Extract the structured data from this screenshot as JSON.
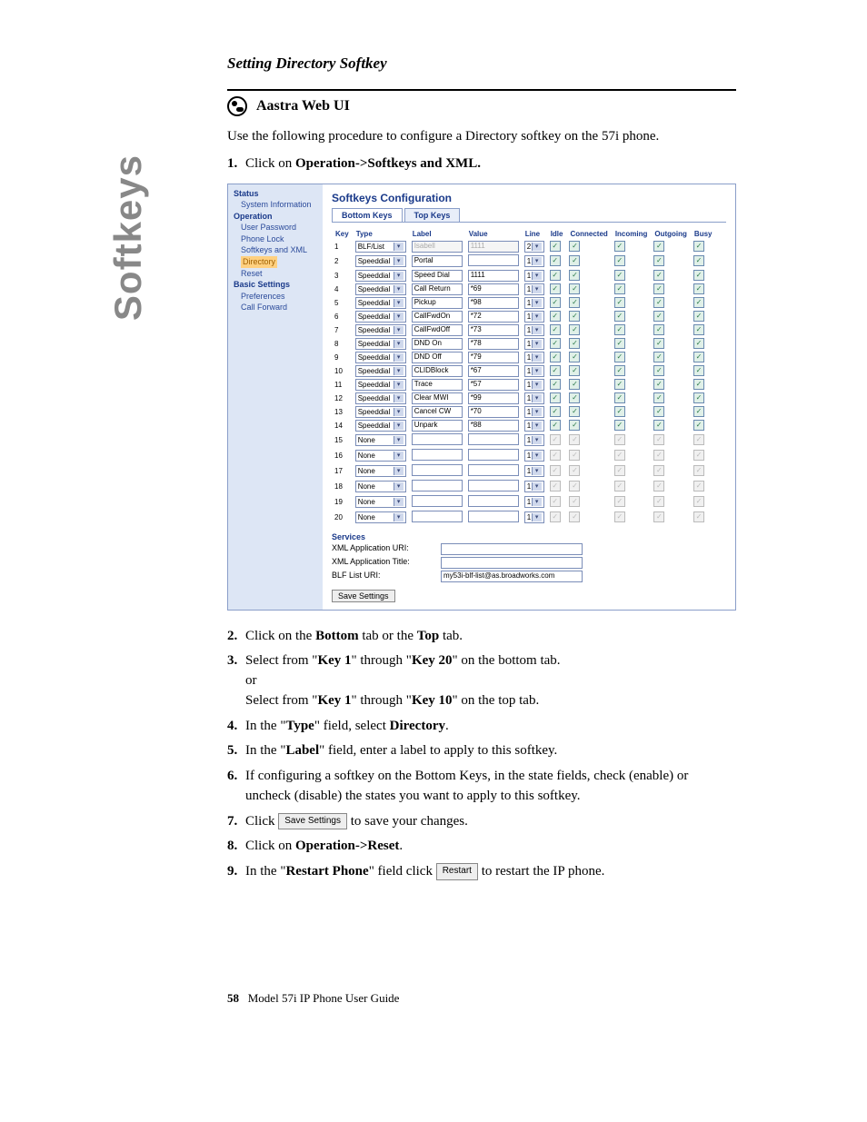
{
  "sidebar_tab": "Softkeys",
  "heading": "Setting Directory Softkey",
  "subhead": "Aastra Web UI",
  "intro": "Use the following procedure to configure a Directory softkey on the 57i phone.",
  "steps": {
    "s1a": "Click on ",
    "s1b": "Operation->Softkeys and XML.",
    "s2a": "Click on the ",
    "s2b": "Bottom",
    "s2c": " tab or the ",
    "s2d": "Top",
    "s2e": " tab.",
    "s3a": "Select from \"",
    "s3b": "Key 1",
    "s3c": "\" through \"",
    "s3d": "Key 20",
    "s3e": "\" on the bottom tab.",
    "s3or": "or",
    "s3f": "Select from \"",
    "s3g": "Key 1",
    "s3h": "\" through \"",
    "s3i": "Key 10",
    "s3j": "\" on the top tab.",
    "s4a": "In the \"",
    "s4b": "Type",
    "s4c": "\" field, select ",
    "s4d": "Directory",
    "s4e": ".",
    "s5a": "In the \"",
    "s5b": "Label",
    "s5c": "\" field, enter a label to apply to this softkey.",
    "s6": "If configuring a softkey on the Bottom Keys, in the state fields, check (enable) or uncheck (disable) the states you want to apply to this softkey.",
    "s7a": "Click ",
    "s7b": " to save your changes.",
    "s8a": "Click on ",
    "s8b": "Operation->Reset",
    "s8c": ".",
    "s9a": "In the \"",
    "s9b": "Restart Phone",
    "s9c": "\" field click ",
    "s9d": " to restart the IP phone."
  },
  "buttons": {
    "save_settings": "Save Settings",
    "restart": "Restart"
  },
  "screenshot": {
    "side": {
      "status": "Status",
      "sysinfo": "System Information",
      "operation": "Operation",
      "userpw": "User Password",
      "phonelock": "Phone Lock",
      "softkeys": "Softkeys and XML",
      "directory": "Directory",
      "reset": "Reset",
      "basic": "Basic Settings",
      "prefs": "Preferences",
      "callfwd": "Call Forward"
    },
    "title": "Softkeys Configuration",
    "tab_bottom": "Bottom Keys",
    "tab_top": "Top Keys",
    "cols": {
      "key": "Key",
      "type": "Type",
      "label": "Label",
      "value": "Value",
      "line": "Line",
      "idle": "Idle",
      "connected": "Connected",
      "incoming": "Incoming",
      "outgoing": "Outgoing",
      "busy": "Busy"
    },
    "rows": [
      {
        "k": "1",
        "type": "BLF/List",
        "label": "Isabell",
        "value": "1111",
        "line": "2",
        "dim_label": true,
        "dim_value": true,
        "enabled": true
      },
      {
        "k": "2",
        "type": "Speeddial",
        "label": "Portal",
        "value": "",
        "line": "1",
        "enabled": true
      },
      {
        "k": "3",
        "type": "Speeddial",
        "label": "Speed Dial",
        "value": "1111",
        "line": "1",
        "enabled": true
      },
      {
        "k": "4",
        "type": "Speeddial",
        "label": "Call Return",
        "value": "*69",
        "line": "1",
        "enabled": true
      },
      {
        "k": "5",
        "type": "Speeddial",
        "label": "Pickup",
        "value": "*98",
        "line": "1",
        "enabled": true
      },
      {
        "k": "6",
        "type": "Speeddial",
        "label": "CallFwdOn",
        "value": "*72",
        "line": "1",
        "enabled": true
      },
      {
        "k": "7",
        "type": "Speeddial",
        "label": "CallFwdOff",
        "value": "*73",
        "line": "1",
        "enabled": true
      },
      {
        "k": "8",
        "type": "Speeddial",
        "label": "DND On",
        "value": "*78",
        "line": "1",
        "enabled": true
      },
      {
        "k": "9",
        "type": "Speeddial",
        "label": "DND Off",
        "value": "*79",
        "line": "1",
        "enabled": true
      },
      {
        "k": "10",
        "type": "Speeddial",
        "label": "CLIDBlock",
        "value": "*67",
        "line": "1",
        "enabled": true
      },
      {
        "k": "11",
        "type": "Speeddial",
        "label": "Trace",
        "value": "*57",
        "line": "1",
        "enabled": true
      },
      {
        "k": "12",
        "type": "Speeddial",
        "label": "Clear MWI",
        "value": "*99",
        "line": "1",
        "enabled": true
      },
      {
        "k": "13",
        "type": "Speeddial",
        "label": "Cancel CW",
        "value": "*70",
        "line": "1",
        "enabled": true
      },
      {
        "k": "14",
        "type": "Speeddial",
        "label": "Unpark",
        "value": "*88",
        "line": "1",
        "enabled": true
      },
      {
        "k": "15",
        "type": "None",
        "label": "",
        "value": "",
        "line": "1",
        "enabled": false
      },
      {
        "k": "16",
        "type": "None",
        "label": "",
        "value": "",
        "line": "1",
        "enabled": false
      },
      {
        "k": "17",
        "type": "None",
        "label": "",
        "value": "",
        "line": "1",
        "enabled": false
      },
      {
        "k": "18",
        "type": "None",
        "label": "",
        "value": "",
        "line": "1",
        "enabled": false
      },
      {
        "k": "19",
        "type": "None",
        "label": "",
        "value": "",
        "line": "1",
        "enabled": false
      },
      {
        "k": "20",
        "type": "None",
        "label": "",
        "value": "",
        "line": "1",
        "enabled": false
      }
    ],
    "services": "Services",
    "xml_uri_label": "XML Application URI:",
    "xml_title_label": "XML Application Title:",
    "blf_label": "BLF List URI:",
    "blf_value": "my53i-blf-list@as.broadworks.com",
    "save": "Save Settings"
  },
  "footer": {
    "page": "58",
    "title": "Model 57i IP Phone User Guide"
  }
}
